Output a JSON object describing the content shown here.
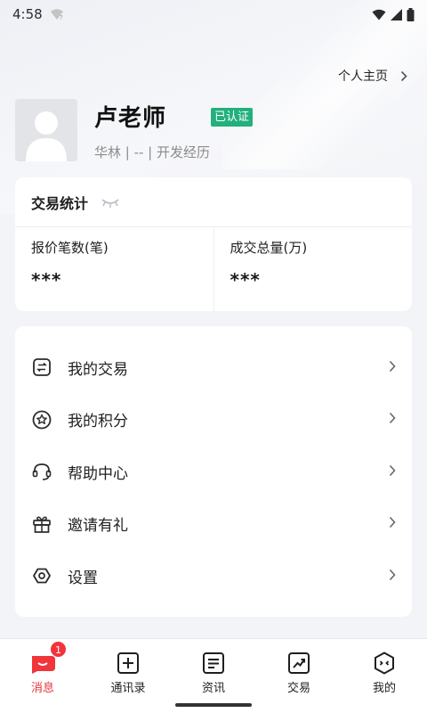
{
  "status_bar": {
    "time": "4:58",
    "icons": [
      "wifi-question-icon",
      "wifi-signal-icon",
      "cell-signal-icon",
      "battery-icon"
    ]
  },
  "header": {
    "profile_link": "个人主页",
    "name": "卢老师",
    "verified_badge": "已认证",
    "subtitle": "华林 | -- | 开发经历",
    "accent_color": "#22b07d"
  },
  "stats": {
    "title": "交易统计",
    "toggle_icon": "eye-closed-icon",
    "columns": [
      {
        "label": "报价笔数(笔)",
        "value": "***"
      },
      {
        "label": "成交总量(万)",
        "value": "***"
      }
    ]
  },
  "menu": {
    "items": [
      {
        "label": "我的交易",
        "icon": "trade-swap-icon"
      },
      {
        "label": "我的积分",
        "icon": "star-circle-icon"
      },
      {
        "label": "帮助中心",
        "icon": "headset-icon"
      },
      {
        "label": "邀请有礼",
        "icon": "gift-icon"
      },
      {
        "label": "设置",
        "icon": "settings-hexagon-icon"
      }
    ]
  },
  "bottom_nav": {
    "active_color": "#e8343a",
    "items": [
      {
        "label": "消息",
        "icon": "message-icon",
        "badge": "1"
      },
      {
        "label": "通讯录",
        "icon": "contacts-plus-icon"
      },
      {
        "label": "资讯",
        "icon": "news-icon"
      },
      {
        "label": "交易",
        "icon": "trade-chart-icon"
      },
      {
        "label": "我的",
        "icon": "profile-hex-icon"
      }
    ]
  }
}
